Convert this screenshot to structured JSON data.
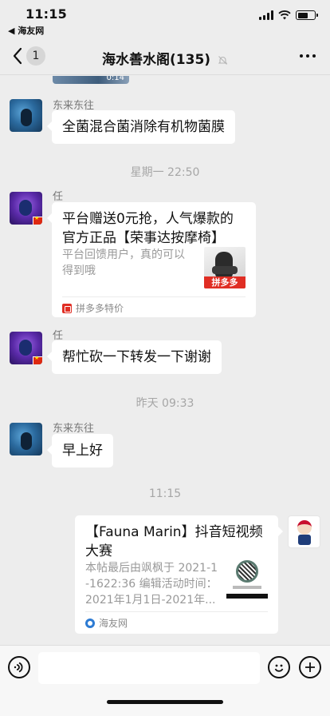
{
  "status_bar": {
    "time": "11:15",
    "back_app": "◀ 海友网",
    "battery_level": 0.6
  },
  "nav": {
    "unread_count": "1",
    "title": "海水善水阁(135)"
  },
  "peek_video": {
    "duration": "0:14"
  },
  "messages": [
    {
      "sender": "东来东往",
      "text": "全菌混合菌消除有机物菌膜"
    },
    {
      "separator": "星期一 22:50"
    },
    {
      "sender": "任",
      "card": {
        "title": "平台赠送0元抢，人气爆款的官方正品【荣事达按摩椅】",
        "title_line1": "平台赠送0元抢，人气爆款的",
        "title_line2": "官方正品【荣事达按摩椅】",
        "desc_line1": "平台回馈用户，真的可以",
        "desc_line2": "得到哦",
        "thumb_badge": "拼多多",
        "source": "拼多多特价"
      }
    },
    {
      "sender": "任",
      "text": "帮忙砍一下转发一下谢谢"
    },
    {
      "separator": "昨天 09:33"
    },
    {
      "sender": "东来东往",
      "text": "早上好"
    },
    {
      "separator": "11:15"
    },
    {
      "card": {
        "title_line1": "【Fauna Marin】抖音短视频",
        "title_line2": "大赛",
        "desc_line1": "本帖最后由飒枫于 2021-1",
        "desc_line2": "-1622:36 编辑活动时间：",
        "desc_line3": "2021年1月1日-2021年...",
        "source": "海友网"
      }
    }
  ],
  "input": {
    "placeholder": ""
  },
  "colors": {
    "background": "#ededed",
    "bubble": "#ffffff",
    "pdd_red": "#e02e24"
  }
}
